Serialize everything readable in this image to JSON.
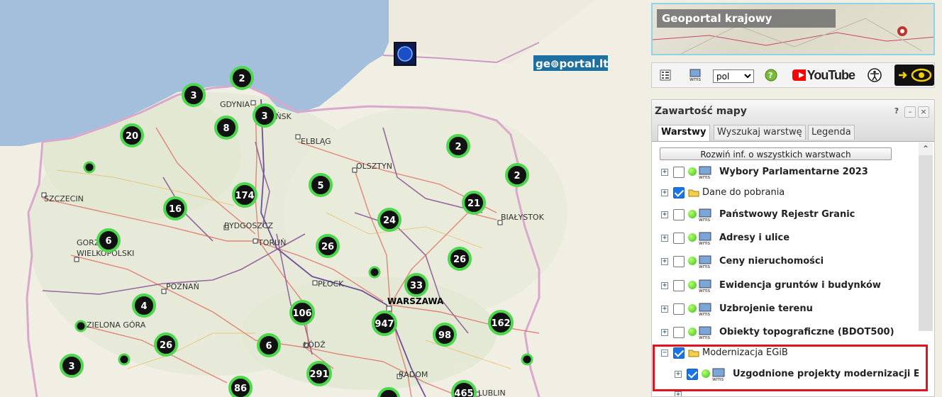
{
  "map": {
    "labels": {
      "gdynia": "GDYNIA",
      "gdansk": "GDAŃSK",
      "elblag": "ELBLĄG",
      "olsztyn": "OLSZTYN",
      "szczecin": "SZCZECIN",
      "bialystok": "BIAŁYSTOK",
      "bydgoszcz": "BYDGOSZCZ",
      "torun": "TORUŃ",
      "gorzow": "GORZ",
      "wielkopolski": "WIELKOPOLSKI",
      "poznan": "POZNAŃ",
      "plock": "PŁOCK",
      "warszawa": "WARSZAWA",
      "zielona_gora": "ZIELONA GÓRA",
      "lodz": "ŁÓDŹ",
      "radom": "RADOM",
      "lublin": "LUBLIN"
    },
    "clusters": {
      "c1": "2",
      "c2": "3",
      "c3": "3",
      "c4": "8",
      "c5": "20",
      "c6": "2",
      "c7": "2",
      "c8": "174",
      "c9": "5",
      "c10": "16",
      "c11": "21",
      "c12": "24",
      "c13": "6",
      "c14": "26",
      "c15": "26",
      "c16": "33",
      "c17": "4",
      "c18": "106",
      "c19": "947",
      "c20": "162",
      "c21": "98",
      "c22": "26",
      "c23": "6",
      "c24": "3",
      "c25": "291",
      "c26": "86",
      "c27": "465"
    },
    "geoportal_lt": "ge⊚portal.lt"
  },
  "banner": {
    "title": "Geoportal krajowy"
  },
  "toolbar": {
    "language": "pol",
    "youtube": "YouTube"
  },
  "panel": {
    "title": "Zawartość mapy",
    "tabs": [
      "Warstwy",
      "Wyszukaj warstwę",
      "Legenda"
    ],
    "expand_all": "Rozwiń inf. o wszystkich warstwach",
    "layers": [
      {
        "label": "Wybory Parlamentarne 2023",
        "checked": false
      },
      {
        "label": "Dane do pobrania",
        "checked": true
      },
      {
        "label": "Państwowy Rejestr Granic",
        "checked": false
      },
      {
        "label": "Adresy i ulice",
        "checked": false
      },
      {
        "label": "Ceny nieruchomości",
        "checked": false
      },
      {
        "label": "Ewidencja gruntów i budynków",
        "checked": false
      },
      {
        "label": "Uzbrojenie terenu",
        "checked": false
      },
      {
        "label": "Obiekty topograficzne (BDOT500)",
        "checked": false
      },
      {
        "label": "Modernizacja EGiB",
        "checked": true
      },
      {
        "label": "Uzgodnione projekty modernizacji EGiB",
        "checked": true
      }
    ]
  },
  "colors": {
    "sea": "#a3bfdc",
    "cluster_ring": "#4cd84c",
    "highlight": "#e0141e",
    "checkbox": "#1a73e8"
  }
}
